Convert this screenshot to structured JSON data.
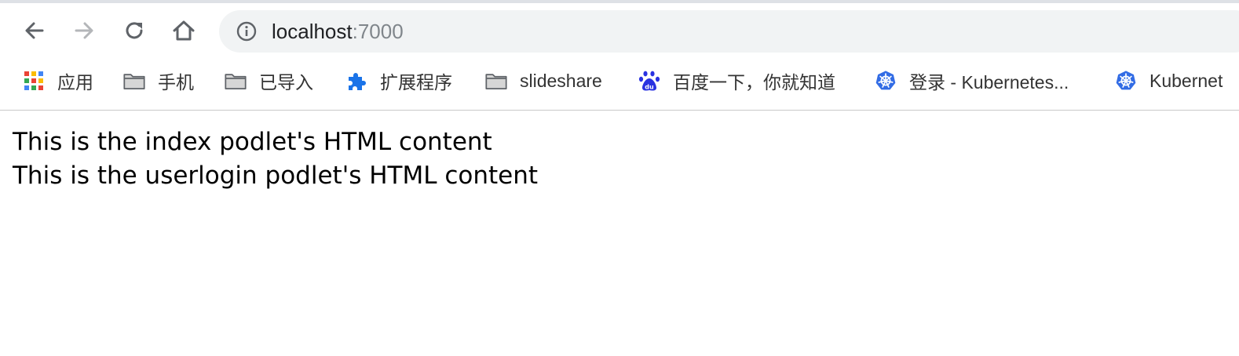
{
  "browser": {
    "url_host": "localhost",
    "url_port": ":7000"
  },
  "bookmarks": [
    {
      "label": "应用",
      "icon": "apps-grid-icon"
    },
    {
      "label": "手机",
      "icon": "folder-icon"
    },
    {
      "label": "已导入",
      "icon": "folder-icon"
    },
    {
      "label": "扩展程序",
      "icon": "puzzle-extension-icon"
    },
    {
      "label": "slideshare",
      "icon": "folder-icon"
    },
    {
      "label": "百度一下，你就知道",
      "icon": "baidu-paw-icon"
    },
    {
      "label": "登录 - Kubernetes...",
      "icon": "kubernetes-icon"
    },
    {
      "label": "Kubernet",
      "icon": "kubernetes-icon"
    }
  ],
  "page": {
    "lines": [
      "This is the index podlet's HTML content",
      "This is the userlogin podlet's HTML content"
    ]
  },
  "colors": {
    "omnibox_bg": "#f1f3f4",
    "kubernetes_blue": "#326ce5",
    "baidu_blue": "#2932e1",
    "extension_blue": "#1a73e8"
  }
}
